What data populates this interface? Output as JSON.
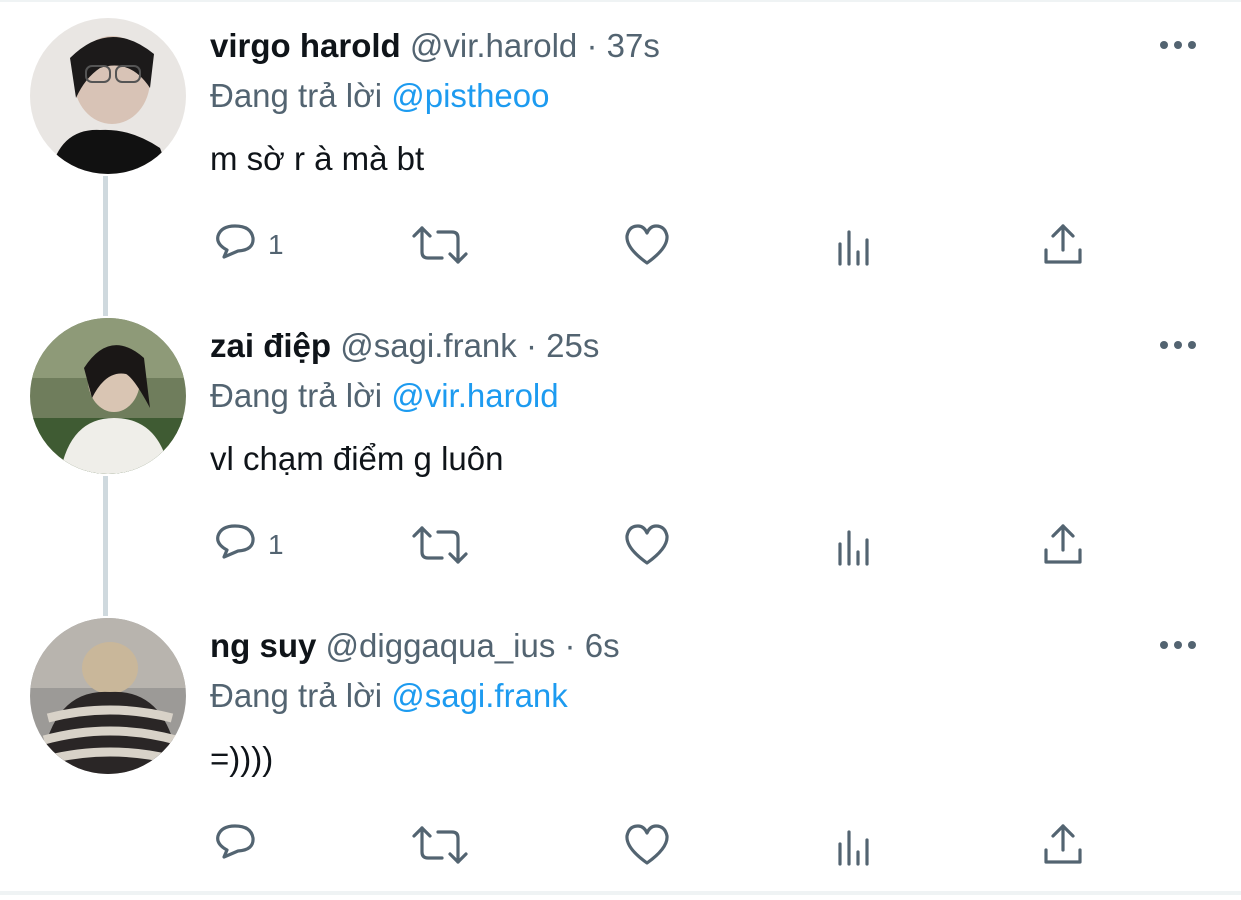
{
  "reply_prefix": "Đang trả lời",
  "tweets": [
    {
      "display_name": "virgo harold",
      "handle": "@vir.harold",
      "separator": "·",
      "time": "37s",
      "reply_to": "@pistheoo",
      "text": "m sờ r à mà bt",
      "reply_count": "1",
      "avatar_icon": "user-avatar-photo"
    },
    {
      "display_name": "zai điệp",
      "handle": "@sagi.frank",
      "separator": "·",
      "time": "25s",
      "reply_to": "@vir.harold",
      "text": "vl chạm điểm g luôn",
      "reply_count": "1",
      "avatar_icon": "user-avatar-photo"
    },
    {
      "display_name": "ng suy",
      "handle": "@diggaqua_ius",
      "separator": "·",
      "time": "6s",
      "reply_to": "@sagi.frank",
      "text": "=))))",
      "reply_count": "",
      "avatar_icon": "user-avatar-photo"
    }
  ],
  "icons": [
    "reply-icon",
    "retweet-icon",
    "like-icon",
    "analytics-icon",
    "share-icon",
    "more-options-icon"
  ],
  "colors": {
    "text_primary": "#0f1419",
    "text_secondary": "#536471",
    "accent": "#1d9bf0",
    "thread_line": "#cfd9de"
  }
}
